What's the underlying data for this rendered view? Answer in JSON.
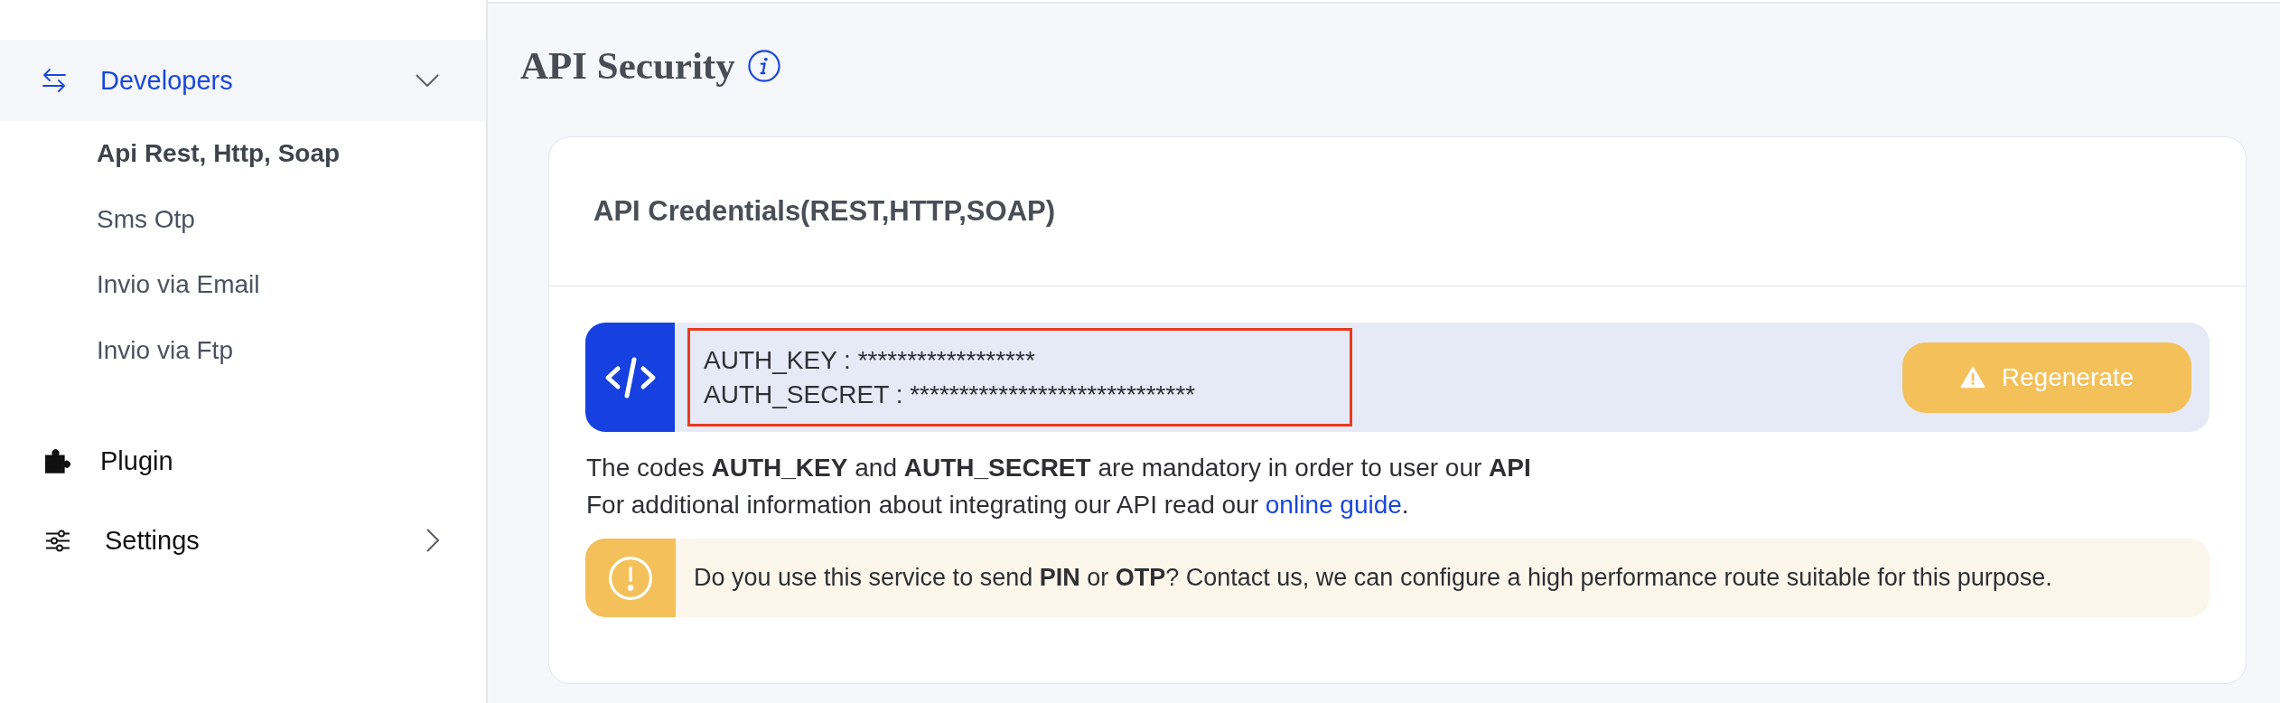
{
  "sidebar": {
    "items": [
      {
        "label": "Developers",
        "kind": "group",
        "selected": true,
        "expanded": true,
        "children": [
          {
            "label": "Api Rest, Http, Soap",
            "selected": true
          },
          {
            "label": "Sms Otp",
            "selected": false
          },
          {
            "label": "Invio via Email",
            "selected": false
          },
          {
            "label": "Invio via Ftp",
            "selected": false
          }
        ]
      },
      {
        "label": "Plugin",
        "kind": "link",
        "selected": false
      },
      {
        "label": "Settings",
        "kind": "group",
        "selected": false,
        "expanded": false
      }
    ]
  },
  "page": {
    "title": "API Security"
  },
  "card": {
    "title": "API Credentials(REST,HTTP,SOAP)",
    "credentials": {
      "highlighted": true,
      "lines": [
        "AUTH_KEY : ******************",
        "AUTH_SECRET : *****************************"
      ]
    },
    "regenerate_button": "Regenerate",
    "description": "The codes **AUTH_KEY** and **AUTH_SECRET** are mandatory in order to user our **API**",
    "guide": {
      "text": "For additional information about integrating our API read our ",
      "link": "online guide",
      "after": "."
    },
    "notice": "Do you use this service to send **PIN** or **OTP**? Contact us, we can configure a high performance route suitable for this purpose."
  }
}
